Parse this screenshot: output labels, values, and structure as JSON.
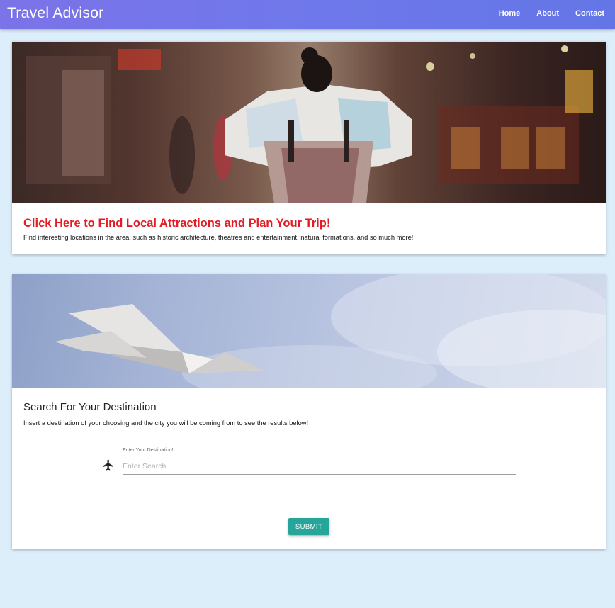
{
  "header": {
    "brand": "Travel Advisor",
    "nav": [
      "Home",
      "About",
      "Contact"
    ]
  },
  "attractions_card": {
    "title": "Click Here to Find Local Attractions and Plan Your Trip!",
    "description": "Find interesting locations in the area, such as historic architecture, theatres and entertainment, natural formations, and so much more!"
  },
  "search_card": {
    "title": "Search For Your Destination",
    "description": "Insert a destination of your choosing and the city you will be coming from to see the results below!",
    "field_label": "Enter Your Destination!",
    "placeholder": "Enter Search",
    "value": "",
    "submit_label": "SUBMIT",
    "icon": "airplane-icon"
  },
  "colors": {
    "header": "#6f76ea",
    "page_background": "#ddeefb",
    "link_red": "#e31b23",
    "submit_teal": "#26a69a"
  }
}
